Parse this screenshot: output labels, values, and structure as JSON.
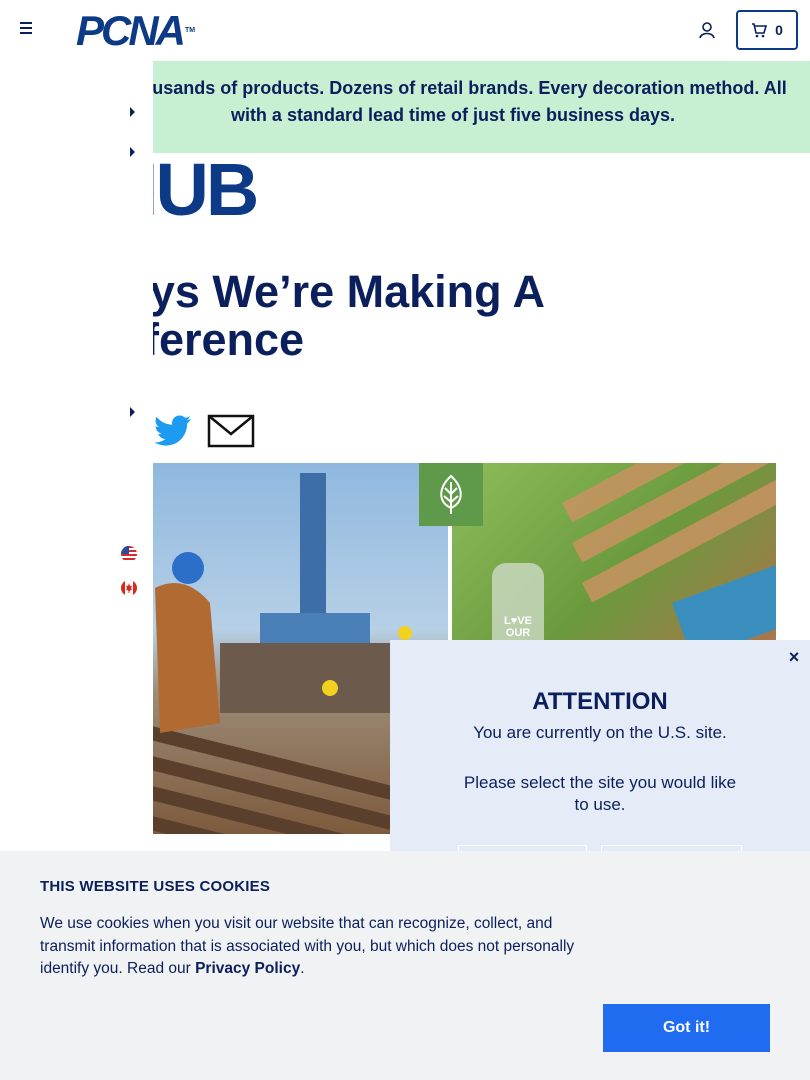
{
  "header": {
    "logo_text": "PCNA",
    "logo_tm": "TM",
    "cart_count": "0",
    "icons": [
      "menu-icon",
      "user-icon",
      "cart-icon"
    ]
  },
  "banner": {
    "text": "Thousands of products. Dozens of retail brands. Every decoration method. All with a standard lead time of just five business days."
  },
  "hub": {
    "text": "HUB"
  },
  "article": {
    "headline": "Ways We’re Making A Difference"
  },
  "share": {
    "icons": [
      "twitter-icon",
      "email-icon"
    ]
  },
  "hero": {
    "bottle_label": "L♥VE OUR"
  },
  "modal": {
    "title": "ATTENTION",
    "line1": "You are currently on the U.S. site.",
    "line2": "Please select the site you would like to use.",
    "close": "×"
  },
  "cookie": {
    "title": "THIS WEBSITE USES COOKIES",
    "body": "We use cookies when you visit our website that can recognize, collect, and transmit information that is associated with you, but which does not personally identify you. Read our ",
    "link": "Privacy Policy",
    "after_link": ".",
    "button": "Got it!"
  },
  "colors": {
    "brand": "#0c3a86",
    "text": "#0b1f5c",
    "banner_bg": "#c7f0d3",
    "modal_bg": "#e5ecf7",
    "cookie_bg": "#f1f2f3",
    "button": "#1f6cf0"
  }
}
